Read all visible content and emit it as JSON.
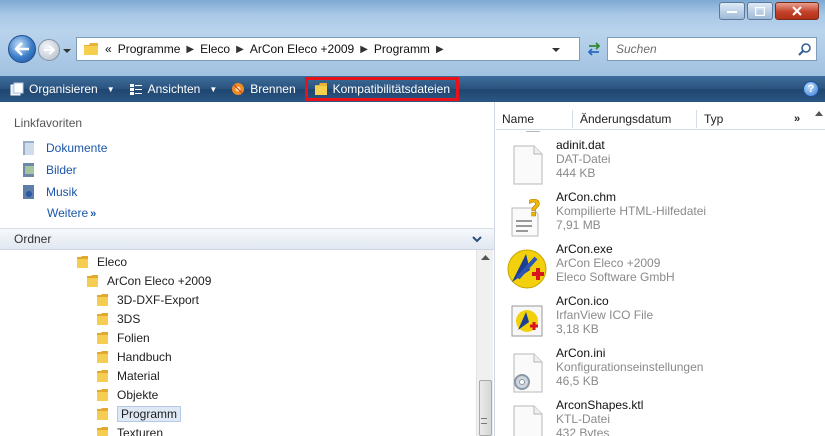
{
  "address": {
    "crumbs": [
      "Programme",
      "Eleco",
      "ArCon Eleco +2009",
      "Programm"
    ],
    "overflow_glyph": "«",
    "search_placeholder": "Suchen"
  },
  "toolbar": {
    "organize": "Organisieren",
    "views": "Ansichten",
    "burn": "Brennen",
    "compat": "Kompatibilitätsdateien",
    "help": "?"
  },
  "nav": {
    "favorites_label": "Linkfavoriten",
    "favorites": [
      "Dokumente",
      "Bilder",
      "Musik"
    ],
    "more_label": "Weitere",
    "more_glyph": "»",
    "folders_label": "Ordner",
    "tree": [
      {
        "label": "Eleco",
        "level": 0
      },
      {
        "label": "ArCon Eleco +2009",
        "level": 1
      },
      {
        "label": "3D-DXF-Export",
        "level": 2
      },
      {
        "label": "3DS",
        "level": 2
      },
      {
        "label": "Folien",
        "level": 2
      },
      {
        "label": "Handbuch",
        "level": 2
      },
      {
        "label": "Material",
        "level": 2
      },
      {
        "label": "Objekte",
        "level": 2
      },
      {
        "label": "Programm",
        "level": 2,
        "selected": true
      },
      {
        "label": "Texturen",
        "level": 2
      }
    ]
  },
  "files": {
    "columns": [
      "Name",
      "Änderungsdatum",
      "Typ"
    ],
    "more_columns": "»",
    "items": [
      {
        "name": "adinit.dat",
        "type": "DAT-Datei",
        "size": "444 KB",
        "icon": "blank-file-icon"
      },
      {
        "name": "ArCon.chm",
        "type": "Kompilierte HTML-Hilfedatei",
        "size": "7,91 MB",
        "icon": "help-file-icon"
      },
      {
        "name": "ArCon.exe",
        "type": "ArCon Eleco +2009",
        "size": "Eleco Software GmbH",
        "icon": "arcon-app-icon"
      },
      {
        "name": "ArCon.ico",
        "type": "IrfanView ICO File",
        "size": "3,18 KB",
        "icon": "arcon-ico-icon"
      },
      {
        "name": "ArCon.ini",
        "type": "Konfigurationseinstellungen",
        "size": "46,5 KB",
        "icon": "settings-file-icon"
      },
      {
        "name": "ArconShapes.ktl",
        "type": "KTL-Datei",
        "size": "432 Bytes",
        "icon": "blank-file-icon"
      }
    ]
  },
  "colors": {
    "highlight": "#e8121b",
    "link": "#1a56a8",
    "folder": "#f0c419"
  }
}
